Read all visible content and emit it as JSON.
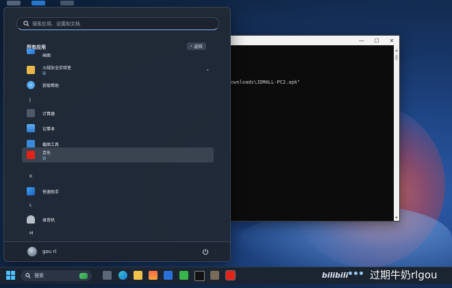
{
  "start_menu": {
    "search_placeholder": "搜索应用、设置和文档",
    "section_title": "所有应用",
    "back_label": "返回",
    "apps": [
      {
        "name": "画图",
        "sub": "",
        "icon": "paint-icon"
      },
      {
        "name": "火绒安全实验室",
        "sub": "新",
        "icon": "folder-icon",
        "expandable": true
      },
      {
        "name": "获取帮助",
        "sub": "",
        "icon": "help-icon"
      },
      {
        "letter": "J"
      },
      {
        "name": "计算器",
        "sub": "",
        "icon": "calculator-icon"
      },
      {
        "name": "记事本",
        "sub": "",
        "icon": "notepad-icon"
      },
      {
        "name": "截图工具",
        "sub": "",
        "icon": "snipping-icon"
      },
      {
        "name": "京东",
        "sub": "新",
        "icon": "jd-icon",
        "highlighted": true
      },
      {
        "letter": "K"
      },
      {
        "name": "快速助手",
        "sub": "",
        "icon": "quick-assist-icon"
      },
      {
        "letter": "L"
      },
      {
        "name": "录音机",
        "sub": "",
        "icon": "recorder-icon"
      },
      {
        "letter": "M"
      }
    ],
    "user_name": "gou rl"
  },
  "terminal": {
    "minimize": "—",
    "maximize": "☐",
    "close": "✕",
    "line": "ownloads\\JDMALL-PC2.apk\""
  },
  "taskbar": {
    "search_label": "搜索",
    "tray_logo": "bilibili",
    "tray_text": "过期牛奶rlgou"
  },
  "colors": {
    "accent": "#7fb2e6",
    "new_badge": "#8fb8e4",
    "menu_bg": "#212936"
  }
}
